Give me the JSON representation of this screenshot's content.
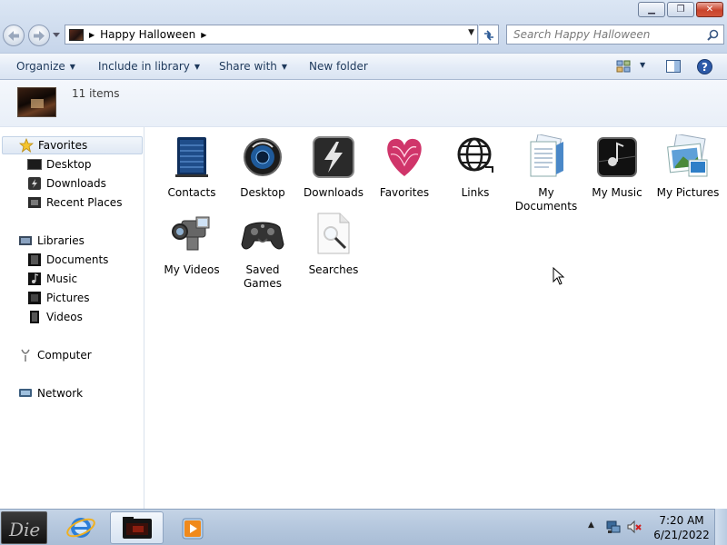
{
  "window": {
    "minimize_glyph": "▁",
    "maximize_glyph": "❐",
    "close_glyph": "✕"
  },
  "address": {
    "crumb": "Happy Halloween"
  },
  "search": {
    "placeholder": "Search Happy Halloween"
  },
  "toolbar": {
    "organize": "Organize",
    "include_in_library": "Include in library",
    "share_with": "Share with",
    "new_folder": "New folder"
  },
  "details": {
    "count": "11 items"
  },
  "navpane": {
    "favorites": "Favorites",
    "desktop": "Desktop",
    "downloads": "Downloads",
    "recent_places": "Recent Places",
    "libraries": "Libraries",
    "documents": "Documents",
    "music": "Music",
    "pictures": "Pictures",
    "videos": "Videos",
    "computer": "Computer",
    "network": "Network"
  },
  "items": [
    {
      "label": "Contacts",
      "icon": "contacts-icon"
    },
    {
      "label": "Desktop",
      "icon": "desktop-icon"
    },
    {
      "label": "Downloads",
      "icon": "downloads-icon"
    },
    {
      "label": "Favorites",
      "icon": "favorites-icon"
    },
    {
      "label": "Links",
      "icon": "links-icon"
    },
    {
      "label": "My Documents",
      "icon": "documents-icon"
    },
    {
      "label": "My Music",
      "icon": "music-icon"
    },
    {
      "label": "My Pictures",
      "icon": "pictures-icon"
    },
    {
      "label": "My Videos",
      "icon": "videos-icon"
    },
    {
      "label": "Saved Games",
      "icon": "games-icon"
    },
    {
      "label": "Searches",
      "icon": "searches-icon"
    }
  ],
  "taskbar": {
    "time": "7:20 AM",
    "date": "6/21/2022"
  }
}
